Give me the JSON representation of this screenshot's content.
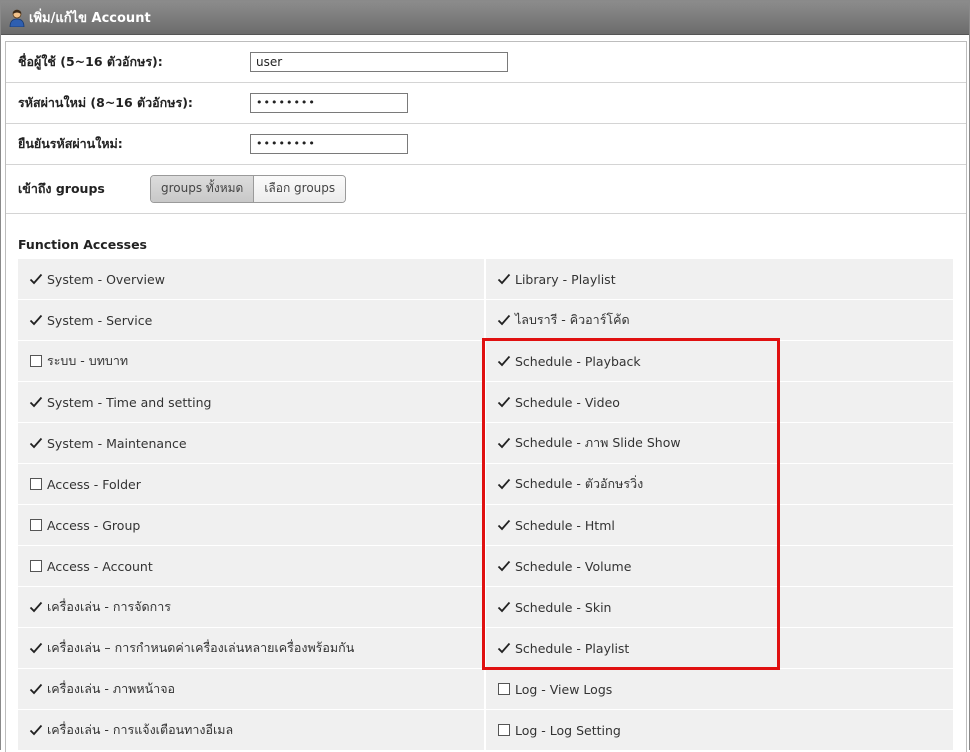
{
  "header": {
    "title": "เพิ่ม/แก้ไข Account",
    "icon": "user-icon"
  },
  "form": {
    "username": {
      "label": "ชื่อผู้ใช้ (5~16 ตัวอักษร):",
      "value": "user"
    },
    "new_password": {
      "label": "รหัสผ่านใหม่ (8~16 ตัวอักษร):",
      "value": "••••••••"
    },
    "confirm_password": {
      "label": "ยืนยันรหัสผ่านใหม่:",
      "value": "••••••••"
    },
    "groups": {
      "label": "เข้าถึง groups",
      "options": [
        "groups ทั้งหมด",
        "เลือก groups"
      ],
      "selected": "groups ทั้งหมด"
    }
  },
  "function_accesses": {
    "title": "Function Accesses",
    "left": [
      {
        "label": "System - Overview",
        "checked": true
      },
      {
        "label": "System - Service",
        "checked": true
      },
      {
        "label": "ระบบ - บทบาท",
        "checked": false
      },
      {
        "label": "System - Time and setting",
        "checked": true
      },
      {
        "label": "System - Maintenance",
        "checked": true
      },
      {
        "label": "Access - Folder",
        "checked": false
      },
      {
        "label": "Access - Group",
        "checked": false
      },
      {
        "label": "Access - Account",
        "checked": false
      },
      {
        "label": "เครื่องเล่น - การจัดการ",
        "checked": true
      },
      {
        "label": "เครื่องเล่น – การกำหนดค่าเครื่องเล่นหลายเครื่องพร้อมกัน",
        "checked": true
      },
      {
        "label": "เครื่องเล่น - ภาพหน้าจอ",
        "checked": true
      },
      {
        "label": "เครื่องเล่น - การแจ้งเตือนทางอีเมล",
        "checked": true
      }
    ],
    "right": [
      {
        "label": "Library - Playlist",
        "checked": true
      },
      {
        "label": "ไลบรารี - คิวอาร์โค้ด",
        "checked": true
      },
      {
        "label": "Schedule - Playback",
        "checked": true
      },
      {
        "label": "Schedule - Video",
        "checked": true
      },
      {
        "label": "Schedule - ภาพ Slide Show",
        "checked": true
      },
      {
        "label": "Schedule - ตัวอักษรวิ่ง",
        "checked": true
      },
      {
        "label": "Schedule - Html",
        "checked": true
      },
      {
        "label": "Schedule - Volume",
        "checked": true
      },
      {
        "label": "Schedule - Skin",
        "checked": true
      },
      {
        "label": "Schedule - Playlist",
        "checked": true
      },
      {
        "label": "Log - View Logs",
        "checked": false
      },
      {
        "label": "Log - Log Setting",
        "checked": false
      }
    ]
  },
  "colors": {
    "highlight": "#e01010",
    "titlebar": "#7a7a7a"
  }
}
